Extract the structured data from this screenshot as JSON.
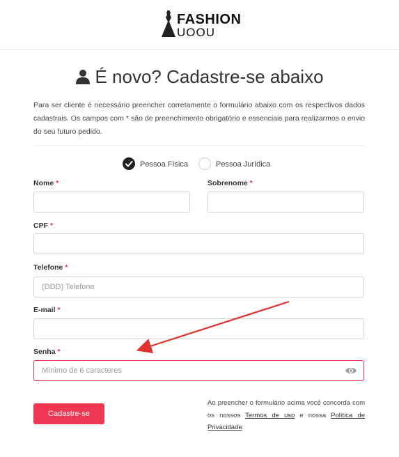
{
  "brand": {
    "logo_top": "FASHION",
    "logo_bottom": "UOOU"
  },
  "page": {
    "title": "É novo? Cadastre-se abaixo",
    "intro": "Para ser cliente é necessário preencher corretamente o formulário abaixo com os respectivos dados cadastrais. Os campos com * são de preenchimento obrigatório e essenciais para realizarmos o envio do seu futuro pedido."
  },
  "person_type": {
    "options": [
      "Pessoa Física",
      "Pessoa Jurídica"
    ],
    "selected": "Pessoa Física"
  },
  "form": {
    "required_mark": "*",
    "nome": {
      "label": "Nome",
      "value": "",
      "placeholder": ""
    },
    "sobrenome": {
      "label": "Sobrenome",
      "value": "",
      "placeholder": ""
    },
    "cpf": {
      "label": "CPF",
      "value": "",
      "placeholder": ""
    },
    "telefone": {
      "label": "Telefone",
      "value": "",
      "placeholder": "(DDD) Telefone"
    },
    "email": {
      "label": "E-mail",
      "value": "",
      "placeholder": ""
    },
    "senha": {
      "label": "Senha",
      "value": "",
      "placeholder": "Mínimo de 6 caracteres"
    },
    "submit_label": "Cadastre-se"
  },
  "terms": {
    "prefix": "Ao preencher o formulário acima você concorda com os nossos",
    "terms_link": "Termos de uso",
    "middle": "e nossa",
    "privacy_link": "Política de Privacidade",
    "suffix": "."
  },
  "colors": {
    "accent": "#ef3752",
    "annotation_arrow": "#e0322e"
  },
  "icons": {
    "title_icon": "user-icon",
    "checked_radio": "check-icon",
    "password_toggle": "eye-icon"
  }
}
